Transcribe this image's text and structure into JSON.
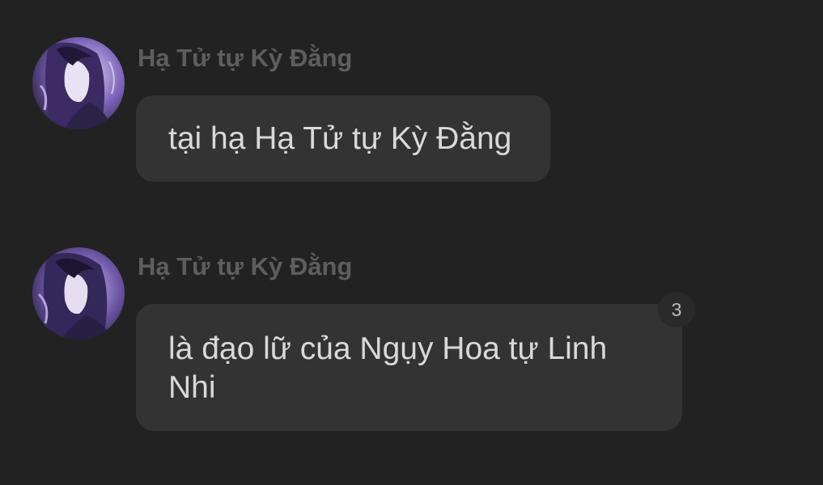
{
  "messages": [
    {
      "sender": "Hạ Tử tự Kỳ Đằng",
      "text": "tại hạ Hạ Tử tự Kỳ Đằng"
    },
    {
      "sender": "Hạ Tử tự Kỳ Đằng",
      "text": "là đạo lữ của Ngụy Hoa tự Linh Nhi",
      "reaction_count": "3"
    }
  ],
  "colors": {
    "background": "#222222",
    "bubble": "#333333",
    "sender_name": "#5e5e5e",
    "message_text": "#d9d9d9",
    "avatar_accent": "#6b4fa3"
  },
  "icons": {
    "avatar": "anime-character-avatar"
  }
}
